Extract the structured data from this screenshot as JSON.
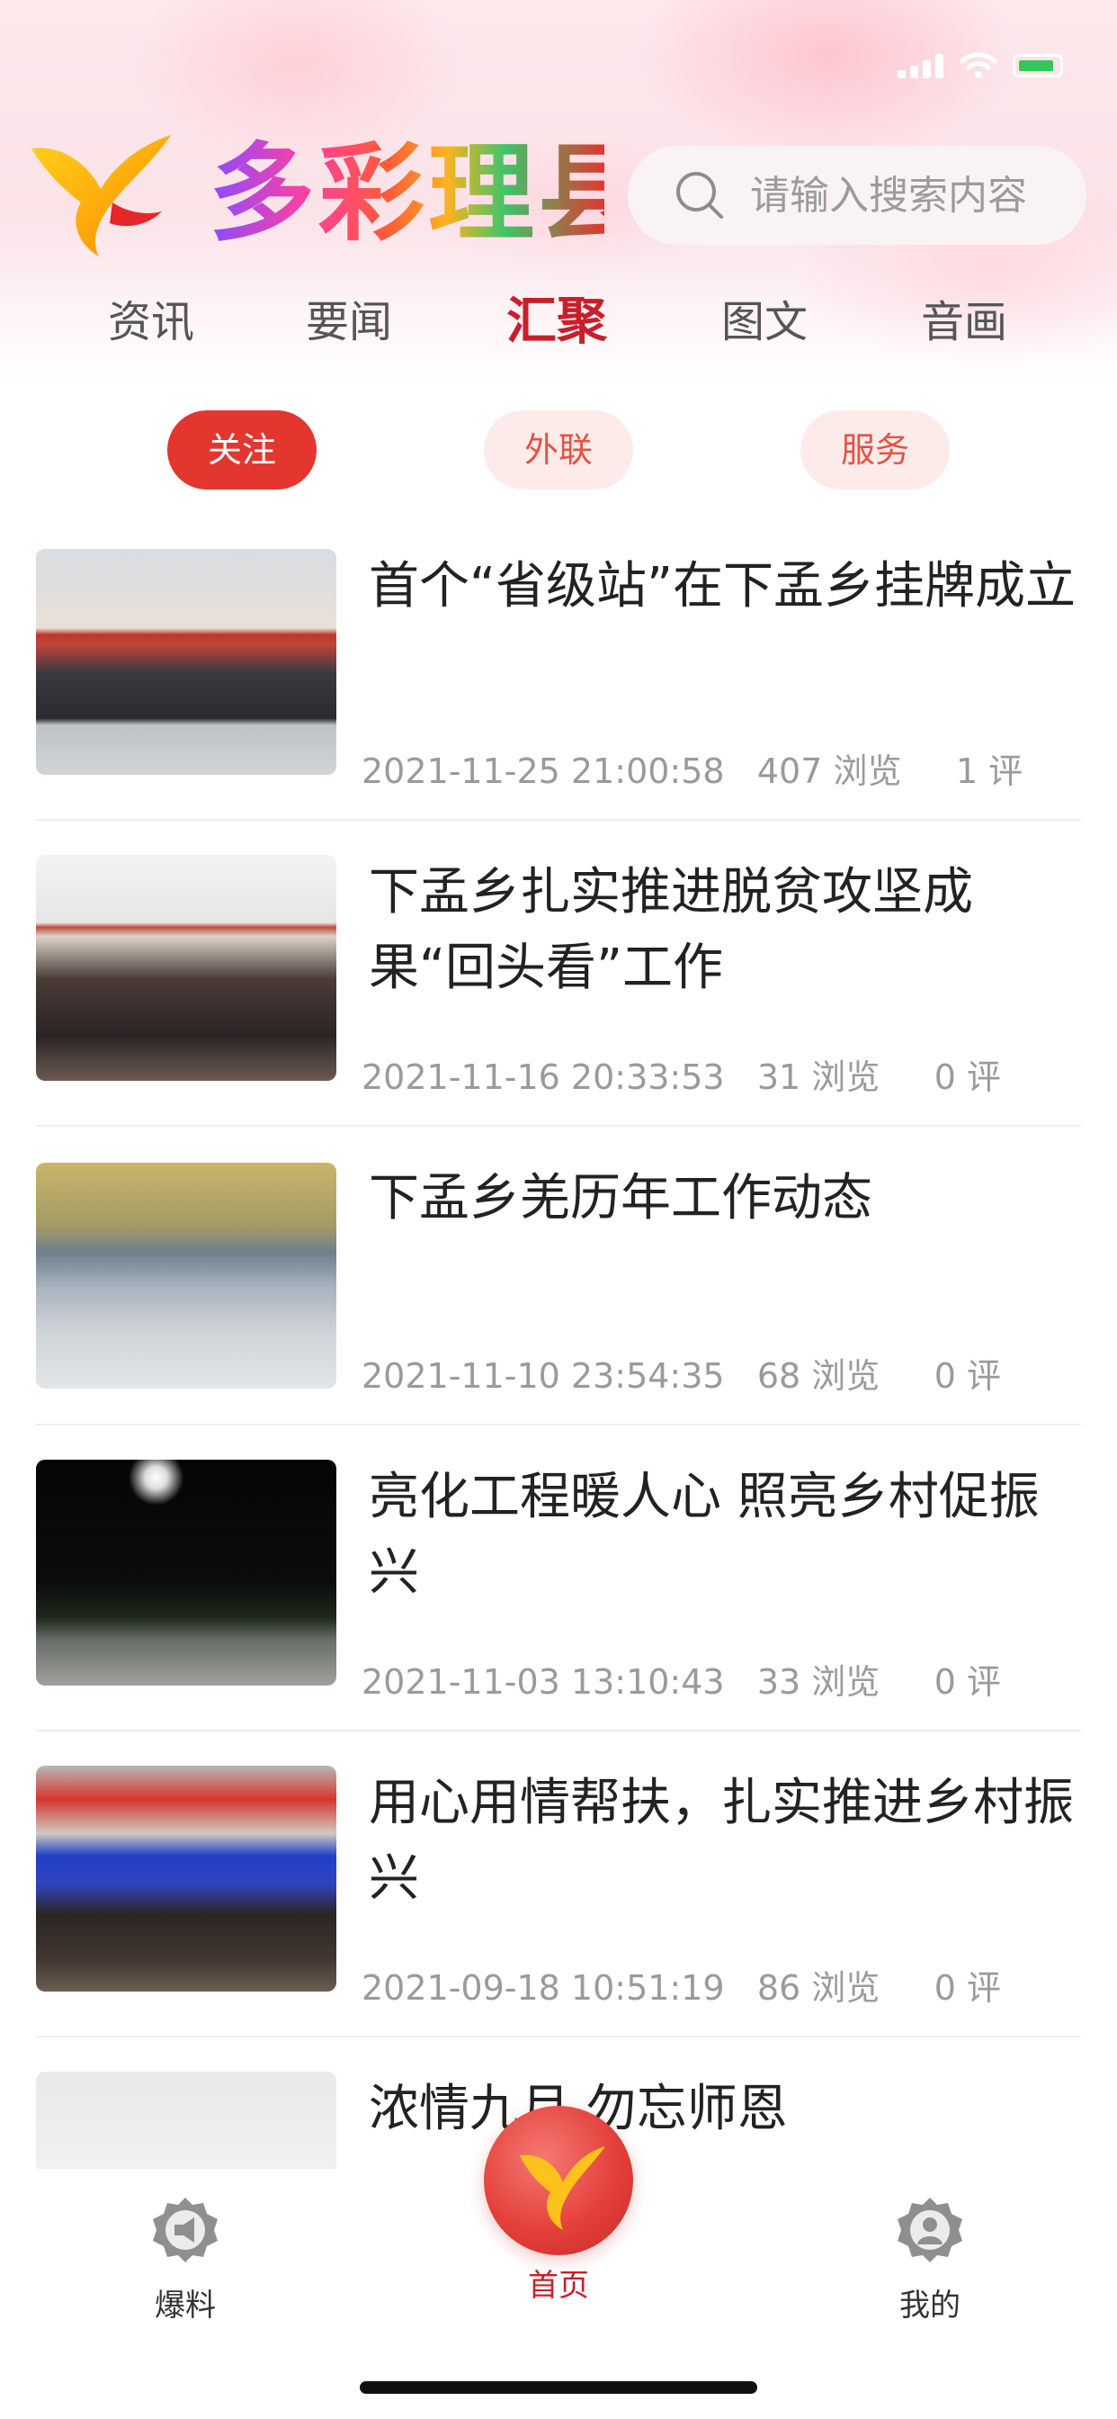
{
  "header": {
    "logo_text": "多彩理县",
    "search_placeholder": "请输入搜索内容"
  },
  "tabs": [
    {
      "label": "资讯"
    },
    {
      "label": "要闻"
    },
    {
      "label": "汇聚",
      "active": true
    },
    {
      "label": "图文"
    },
    {
      "label": "音画"
    }
  ],
  "sub_tabs": [
    {
      "label": "关注",
      "active": true
    },
    {
      "label": "外联"
    },
    {
      "label": "服务"
    }
  ],
  "news": [
    {
      "title": "首个“省级站”在下孟乡挂牌成立",
      "date": "2021-11-25 21:00:58",
      "views": "407 浏览",
      "comments": "1 评"
    },
    {
      "title": "下孟乡扎实推进脱贫攻坚成果“回头看”工作",
      "date": "2021-11-16 20:33:53",
      "views": "31 浏览",
      "comments": "0 评"
    },
    {
      "title": "下孟乡羌历年工作动态",
      "date": "2021-11-10 23:54:35",
      "views": "68 浏览",
      "comments": "0 评"
    },
    {
      "title": "亮化工程暖人心 照亮乡村促振兴",
      "date": "2021-11-03 13:10:43",
      "views": "33 浏览",
      "comments": "0 评"
    },
    {
      "title": "用心用情帮扶，扎实推进乡村振兴",
      "date": "2021-09-18 10:51:19",
      "views": "86 浏览",
      "comments": "0 评"
    },
    {
      "title": "浓情九月 勿忘师恩",
      "date": "",
      "views": "",
      "comments": ""
    }
  ],
  "bottom_nav": {
    "left": "爆料",
    "center": "首页",
    "right": "我的"
  },
  "colors": {
    "accent": "#c8202a",
    "pill_active": "#e2362f",
    "pill_inactive_bg": "#fdebea"
  }
}
